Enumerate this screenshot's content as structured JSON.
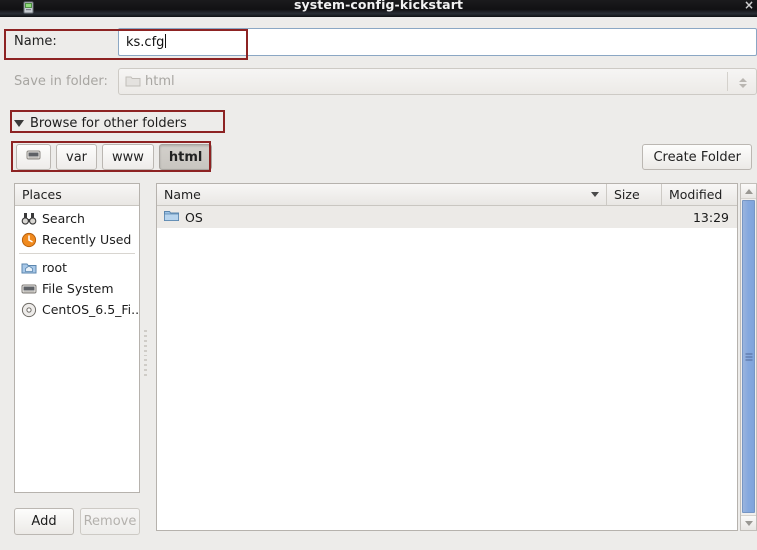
{
  "window": {
    "title": "system-config-kickstart",
    "close_label": "×",
    "app_icon": "app-icon"
  },
  "dialog": {
    "name_field": {
      "label": "Name:",
      "value": "ks.cfg",
      "placeholder": ""
    },
    "save_in_folder": {
      "label": "Save in folder:",
      "value": "html",
      "icon": "folder-icon",
      "enabled": false
    },
    "browse_expander": {
      "label": "Browse for other folders",
      "expanded": true,
      "icon": "triangle-down-icon"
    },
    "path_bar": {
      "root_icon": "filesystem-icon",
      "segments": [
        {
          "label": "var",
          "active": false
        },
        {
          "label": "www",
          "active": false
        },
        {
          "label": "html",
          "active": true
        }
      ]
    },
    "create_folder_button": "Create Folder"
  },
  "places": {
    "header": "Places",
    "items": [
      {
        "label": "Search",
        "icon": "search-binoculars-icon"
      },
      {
        "label": "Recently Used",
        "icon": "recent-clock-icon"
      },
      {
        "label": "root",
        "icon": "home-folder-icon"
      },
      {
        "label": "File System",
        "icon": "drive-icon"
      },
      {
        "label": "CentOS_6.5_Fi...",
        "icon": "disc-icon"
      }
    ],
    "add_button": "Add",
    "remove_button": "Remove",
    "remove_enabled": false
  },
  "file_list": {
    "columns": [
      "Name",
      "Size",
      "Modified"
    ],
    "sort_column": "Name",
    "rows": [
      {
        "name": "OS",
        "size": "",
        "modified": "13:29",
        "icon": "folder-icon",
        "selected": true
      }
    ]
  },
  "scrollbar": {
    "up_icon": "chevron-up-icon",
    "down_icon": "chevron-down-icon"
  },
  "colors": {
    "annotation": "#8d2323",
    "window_bg": "#edecea",
    "entry_border": "#8ba7c4",
    "scroll_thumb": "#86a9de"
  }
}
